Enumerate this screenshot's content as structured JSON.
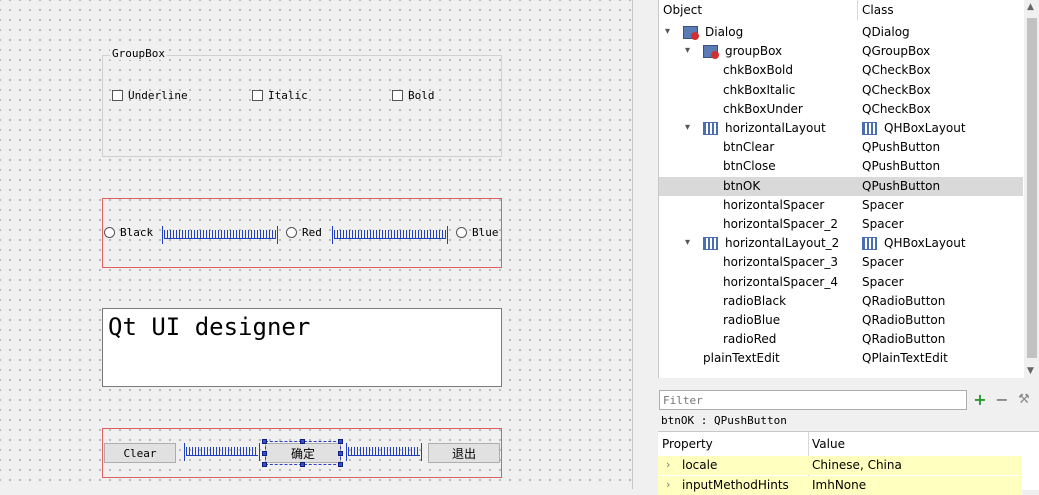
{
  "form": {
    "groupbox_title": "GroupBox",
    "checkboxes": [
      "Underline",
      "Italic",
      "Bold"
    ],
    "radios": [
      "Black",
      "Red",
      "Blue"
    ],
    "plaintext": "Qt UI designer",
    "buttons": {
      "clear": "Clear",
      "ok": "确定",
      "close": "退出"
    }
  },
  "inspector": {
    "col_object": "Object",
    "col_class": "Class",
    "rows": [
      {
        "name": "Dialog",
        "cls": "QDialog"
      },
      {
        "name": "groupBox",
        "cls": "QGroupBox"
      },
      {
        "name": "chkBoxBold",
        "cls": "QCheckBox"
      },
      {
        "name": "chkBoxItalic",
        "cls": "QCheckBox"
      },
      {
        "name": "chkBoxUnder",
        "cls": "QCheckBox"
      },
      {
        "name": "horizontalLayout",
        "cls": "QHBoxLayout"
      },
      {
        "name": "btnClear",
        "cls": "QPushButton"
      },
      {
        "name": "btnClose",
        "cls": "QPushButton"
      },
      {
        "name": "btnOK",
        "cls": "QPushButton"
      },
      {
        "name": "horizontalSpacer",
        "cls": "Spacer"
      },
      {
        "name": "horizontalSpacer_2",
        "cls": "Spacer"
      },
      {
        "name": "horizontalLayout_2",
        "cls": "QHBoxLayout"
      },
      {
        "name": "horizontalSpacer_3",
        "cls": "Spacer"
      },
      {
        "name": "horizontalSpacer_4",
        "cls": "Spacer"
      },
      {
        "name": "radioBlack",
        "cls": "QRadioButton"
      },
      {
        "name": "radioBlue",
        "cls": "QRadioButton"
      },
      {
        "name": "radioRed",
        "cls": "QRadioButton"
      },
      {
        "name": "plainTextEdit",
        "cls": "QPlainTextEdit"
      }
    ]
  },
  "filter": {
    "placeholder": "Filter"
  },
  "selected_object": "btnOK : QPushButton",
  "property_editor": {
    "col_property": "Property",
    "col_value": "Value",
    "rows": [
      {
        "name": "locale",
        "value": "Chinese, China"
      },
      {
        "name": "inputMethodHints",
        "value": "ImhNone"
      }
    ]
  }
}
